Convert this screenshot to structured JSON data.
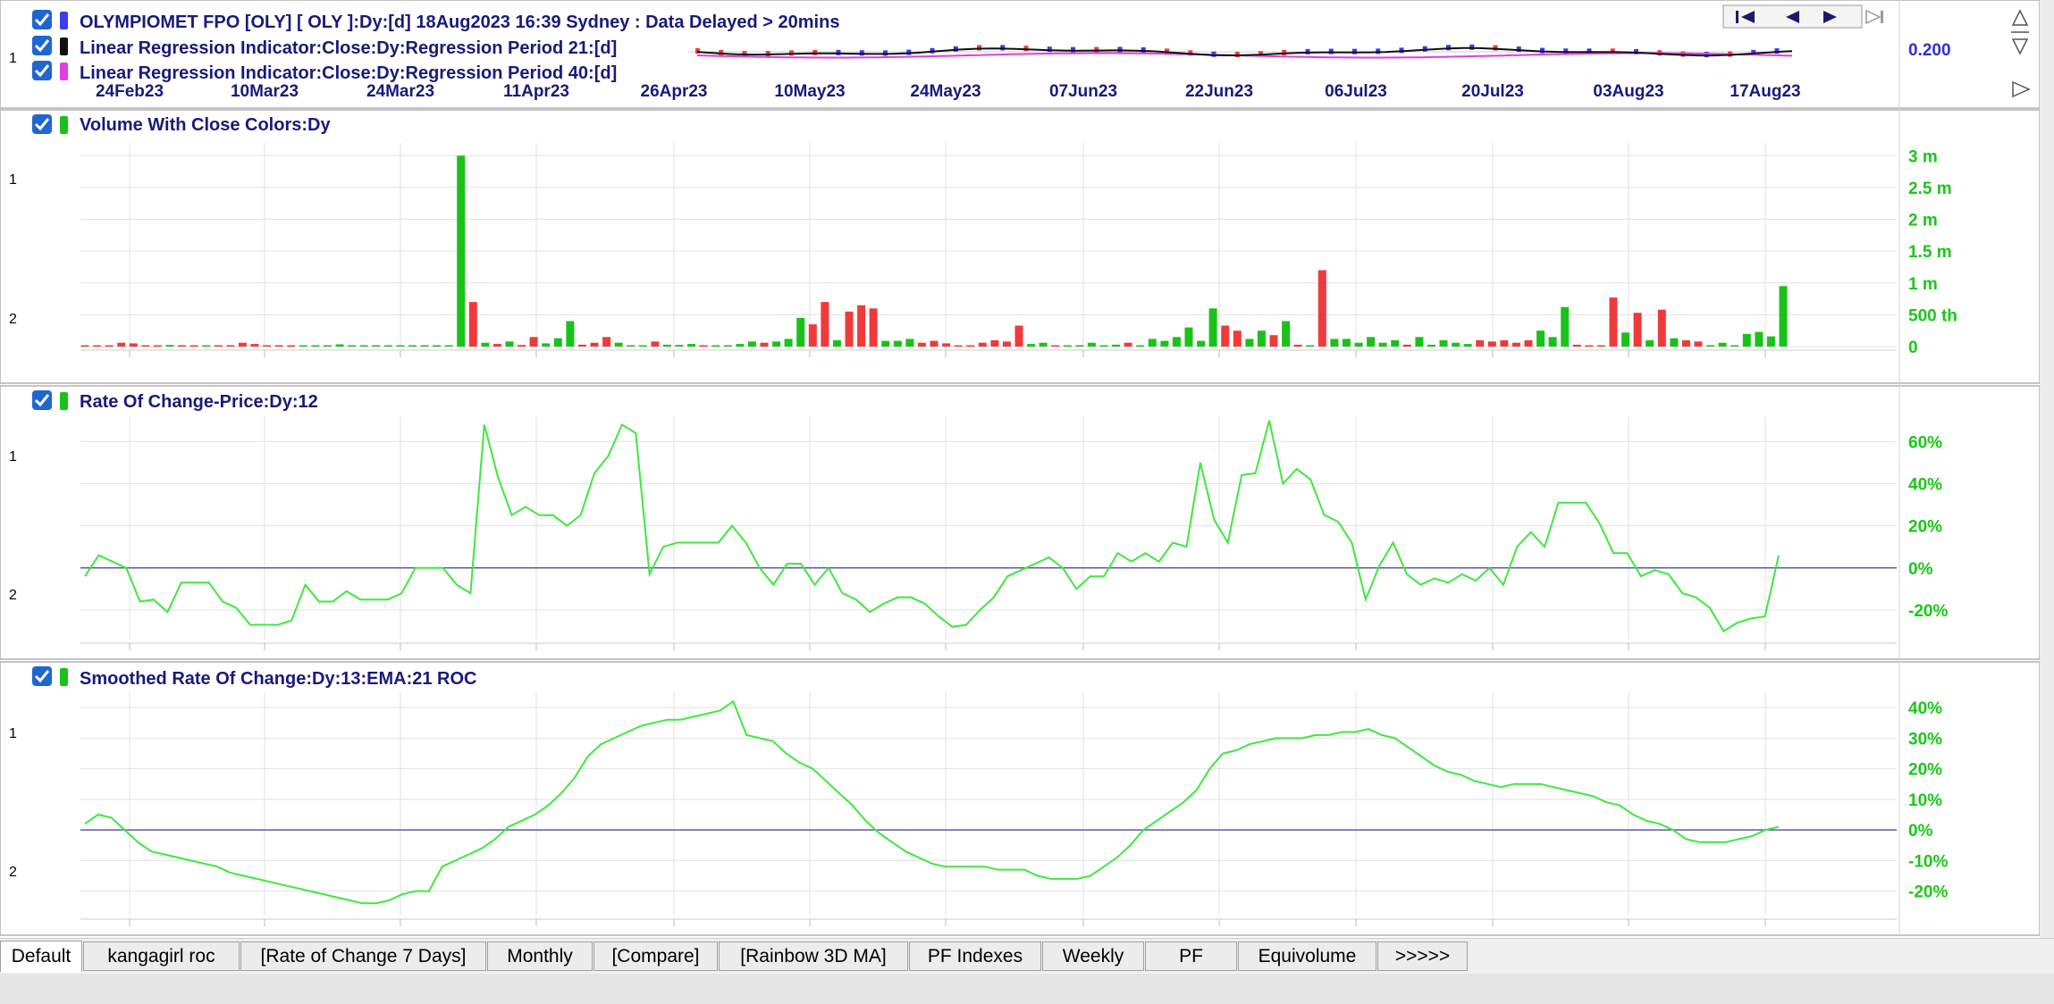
{
  "colors": {
    "up": "#19c219",
    "down": "#f03a3a",
    "roc_line": "#3fe83f",
    "zero_line": "#5a5aa8",
    "grid": "#e2e2e2",
    "title_text": "#1a1a7a",
    "axis_green": "#18c818",
    "axis_blue": "#2f2fd8",
    "checkbox": "#1f66d0"
  },
  "top_panel": {
    "title": "OLYMPIOMET FPO [OLY] [ OLY ]:Dy:[d]  18Aug2023 16:39 Sydney : Data Delayed > 20mins",
    "indicator_1": "Linear Regression Indicator:Close:Dy:Regression Period 21:[d]",
    "indicator_2": "Linear Regression Indicator:Close:Dy:Regression Period 40:[d]",
    "price_label": "0.200",
    "row_label": "1",
    "title_icon": "blue-square-icon",
    "indicator_1_icon": "black-square-icon",
    "indicator_2_icon": "magenta-square-icon",
    "nav_first_icon": "skip-first-icon",
    "nav_prev_icon": "arrow-left-icon",
    "nav_next_icon": "arrow-right-icon",
    "nav_last_icon": "skip-last-icon"
  },
  "date_axis": [
    "24Feb23",
    "10Mar23",
    "24Mar23",
    "11Apr23",
    "26Apr23",
    "10May23",
    "24May23",
    "07Jun23",
    "22Jun23",
    "06Jul23",
    "20Jul23",
    "03Aug23",
    "17Aug23"
  ],
  "tabs": [
    {
      "label": "Default",
      "active": true
    },
    {
      "label": "kangagirl roc",
      "active": false
    },
    {
      "label": "[Rate of Change 7 Days]",
      "active": false
    },
    {
      "label": "Monthly",
      "active": false
    },
    {
      "label": "[Compare]",
      "active": false
    },
    {
      "label": "[Rainbow 3D MA]",
      "active": false
    },
    {
      "label": "PF Indexes",
      "active": false
    },
    {
      "label": "Weekly",
      "active": false
    },
    {
      "label": "PF",
      "active": false
    },
    {
      "label": "Equivolume",
      "active": false
    },
    {
      "label": ">>>>>",
      "active": false
    }
  ],
  "chart_data": [
    {
      "type": "bar",
      "title": "Volume With Close Colors:Dy",
      "row_labels": [
        "1",
        "2"
      ],
      "y_ticks": [
        "3 m",
        "2.5 m",
        "2 m",
        "1.5 m",
        "1 m",
        "500 th",
        "0"
      ],
      "y_tick_values": [
        3000000,
        2500000,
        2000000,
        1500000,
        1000000,
        500000,
        0
      ],
      "ylim": [
        0,
        3200000
      ],
      "x_date_range": [
        "20Feb23",
        "18Aug23"
      ],
      "grid": true,
      "series": [
        {
          "values": [
            12000,
            15000,
            10000,
            60000,
            50000,
            20000,
            12000,
            25000,
            12000,
            15000,
            12000,
            20000,
            12000,
            60000,
            40000,
            12000,
            10000,
            12000,
            20000,
            15000,
            12000,
            35000,
            15000,
            8000,
            10000,
            12000,
            20000,
            10000,
            15000,
            8000,
            10000,
            3000000,
            700000,
            60000,
            40000,
            80000,
            25000,
            150000,
            50000,
            130000,
            400000,
            30000,
            60000,
            150000,
            60000,
            20000,
            20000,
            80000,
            30000,
            25000,
            40000,
            12000,
            12000,
            20000,
            40000,
            80000,
            60000,
            80000,
            120000,
            450000,
            350000,
            700000,
            100000,
            550000,
            650000,
            600000,
            90000,
            90000,
            120000,
            60000,
            90000,
            50000,
            20000,
            20000,
            60000,
            100000,
            80000,
            330000,
            40000,
            60000,
            20000,
            10000,
            20000,
            60000,
            10000,
            30000,
            60000,
            20000,
            120000,
            90000,
            150000,
            300000,
            90000,
            600000,
            330000,
            250000,
            120000,
            250000,
            180000,
            400000,
            30000,
            20000,
            1200000,
            120000,
            120000,
            60000,
            150000,
            60000,
            100000,
            30000,
            150000,
            30000,
            100000,
            60000,
            40000,
            100000,
            80000,
            100000,
            60000,
            100000,
            250000,
            150000,
            620000,
            30000,
            10000,
            20000,
            770000,
            220000,
            530000,
            100000,
            580000,
            130000,
            100000,
            80000,
            20000,
            60000,
            20000,
            200000,
            230000,
            160000,
            950000
          ],
          "colors": [
            "down",
            "down",
            "down",
            "down",
            "down",
            "down",
            "down",
            "up",
            "down",
            "down",
            "up",
            "down",
            "down",
            "down",
            "down",
            "down",
            "down",
            "down",
            "up",
            "up",
            "up",
            "up",
            "up",
            "up",
            "up",
            "up",
            "up",
            "up",
            "up",
            "up",
            "up",
            "up",
            "down",
            "up",
            "down",
            "up",
            "down",
            "down",
            "up",
            "up",
            "up",
            "down",
            "down",
            "down",
            "up",
            "up",
            "up",
            "down",
            "up",
            "up",
            "up",
            "down",
            "up",
            "up",
            "up",
            "up",
            "down",
            "up",
            "up",
            "up",
            "down",
            "down",
            "up",
            "down",
            "down",
            "down",
            "up",
            "up",
            "up",
            "down",
            "down",
            "down",
            "down",
            "down",
            "down",
            "down",
            "down",
            "down",
            "up",
            "up",
            "down",
            "up",
            "up",
            "up",
            "up",
            "up",
            "down",
            "up",
            "up",
            "up",
            "up",
            "up",
            "up",
            "up",
            "down",
            "down",
            "up",
            "up",
            "down",
            "up",
            "down",
            "up",
            "down",
            "up",
            "up",
            "up",
            "up",
            "up",
            "up",
            "down",
            "up",
            "up",
            "up",
            "up",
            "up",
            "down",
            "down",
            "down",
            "down",
            "down",
            "up",
            "up",
            "up",
            "down",
            "down",
            "down",
            "down",
            "up",
            "down",
            "up",
            "down",
            "up",
            "down",
            "down",
            "up",
            "up",
            "up",
            "up",
            "up",
            "up",
            "up"
          ]
        }
      ]
    },
    {
      "type": "line",
      "title": "Rate Of Change-Price:Dy:12",
      "row_labels": [
        "1",
        "2"
      ],
      "y_ticks": [
        "60%",
        "40%",
        "20%",
        "0%",
        "-20%"
      ],
      "y_tick_values": [
        60,
        40,
        20,
        0,
        -20
      ],
      "ylim": [
        -34,
        72
      ],
      "x_date_range": [
        "20Feb23",
        "18Aug23"
      ],
      "grid": true,
      "series": [
        {
          "values": [
            -4,
            6,
            3,
            0,
            -16,
            -15,
            -21,
            -7,
            -7,
            -7,
            -16,
            -19,
            -27,
            -27,
            -27,
            -25,
            -8,
            -16,
            -16,
            -11,
            -15,
            -15,
            -15,
            -12,
            0,
            0,
            0,
            -8,
            -12,
            68,
            43,
            25,
            29,
            25,
            25,
            20,
            25,
            45,
            53,
            68,
            64,
            -3,
            10,
            12,
            12,
            12,
            12,
            20,
            12,
            0,
            -8,
            2,
            2,
            -8,
            0,
            -12,
            -15,
            -21,
            -17,
            -14,
            -14,
            -17,
            -23,
            -28,
            -27,
            -20,
            -14,
            -4,
            -1,
            2,
            5,
            0,
            -10,
            -4,
            -4,
            7,
            3,
            7,
            3,
            12,
            10,
            50,
            23,
            12,
            44,
            45,
            70,
            40,
            47,
            42,
            25,
            22,
            12,
            -15,
            1,
            12,
            -3,
            -8,
            -5,
            -7,
            -3,
            -6,
            0,
            -8,
            10,
            17,
            10,
            31,
            31,
            31,
            21,
            7,
            7,
            -4,
            -1,
            -3,
            -12,
            -14,
            -19,
            -30,
            -26,
            -24,
            -23,
            6
          ]
        }
      ]
    },
    {
      "type": "line",
      "title": "Smoothed Rate Of Change:Dy:13:EMA:21 ROC",
      "row_labels": [
        "1",
        "2"
      ],
      "y_ticks": [
        "40%",
        "30%",
        "20%",
        "10%",
        "0%",
        "-10%",
        "-20%"
      ],
      "y_tick_values": [
        40,
        30,
        20,
        10,
        0,
        -10,
        -20
      ],
      "ylim": [
        -28,
        45
      ],
      "x_date_range": [
        "20Feb23",
        "18Aug23"
      ],
      "grid": true,
      "series": [
        {
          "values": [
            2,
            5,
            4,
            0,
            -4,
            -7,
            -8,
            -9,
            -10,
            -11,
            -12,
            -14,
            -15,
            -16,
            -17,
            -18,
            -19,
            -20,
            -21,
            -22,
            -23,
            -24,
            -24,
            -23,
            -21,
            -20,
            -20,
            -12,
            -10,
            -8,
            -6,
            -3,
            1,
            3,
            5,
            8,
            12,
            17,
            24,
            28,
            30,
            32,
            34,
            35,
            36,
            36,
            37,
            38,
            39,
            42,
            31,
            30,
            29,
            25,
            22,
            20,
            16,
            12,
            8,
            3,
            -1,
            -4,
            -7,
            -9,
            -11,
            -12,
            -12,
            -12,
            -12,
            -13,
            -13,
            -13,
            -15,
            -16,
            -16,
            -16,
            -15,
            -12,
            -9,
            -5,
            0,
            3,
            6,
            9,
            13,
            20,
            25,
            26,
            28,
            29,
            30,
            30,
            30,
            31,
            31,
            32,
            32,
            33,
            31,
            30,
            27,
            24,
            21,
            19,
            18,
            16,
            15,
            14,
            15,
            15,
            15,
            14,
            13,
            12,
            11,
            9,
            8,
            5,
            3,
            2,
            0,
            -3,
            -4,
            -4,
            -4,
            -3,
            -2,
            0,
            1
          ]
        }
      ]
    }
  ]
}
